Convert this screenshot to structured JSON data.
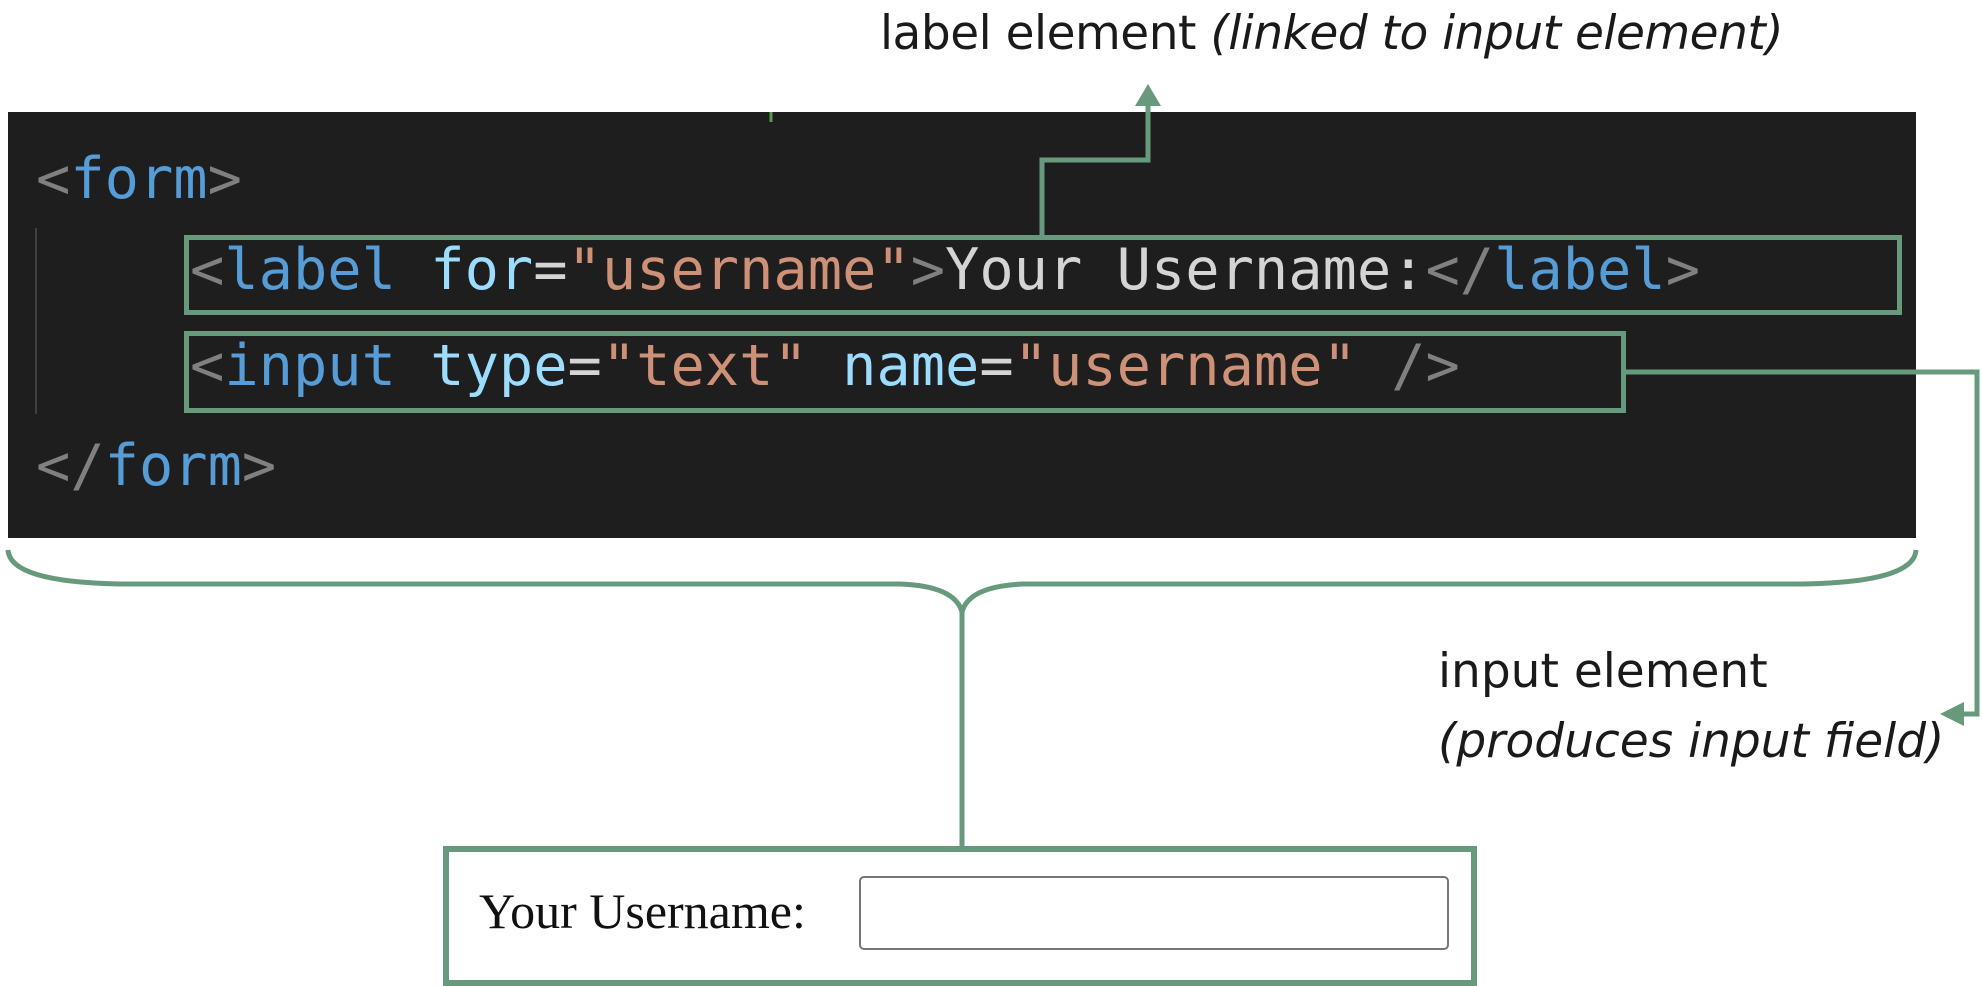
{
  "callouts": {
    "label_main": "label element",
    "label_note": "(linked to input element)",
    "input_main": "input element",
    "input_note": "(produces input field)"
  },
  "code": {
    "line1": {
      "open": "<",
      "tag": "form",
      "close": ">"
    },
    "line2": {
      "open": "<",
      "tag": "label",
      "attr": "for",
      "eq": "=",
      "value": "\"username\"",
      "close": ">",
      "text": "Your Username:",
      "end_open": "</",
      "end_tag": "label",
      "end_close": ">"
    },
    "line3": {
      "open": "<",
      "tag": "input",
      "attr1": "type",
      "eq1": "=",
      "value1": "\"text\"",
      "attr2": "name",
      "eq2": "=",
      "value2": "\"username\"",
      "close": "/>"
    },
    "line4": {
      "open": "</",
      "tag": "form",
      "close": ">"
    }
  },
  "rendered": {
    "label": "Your Username:",
    "input_value": ""
  },
  "colors": {
    "accent": "#679a7d",
    "code_background": "#1e1e1e",
    "tag": "#569cd6",
    "attribute": "#9cdcfe",
    "string": "#ce9178",
    "bracket": "#808080",
    "text": "#d4d4d4"
  }
}
